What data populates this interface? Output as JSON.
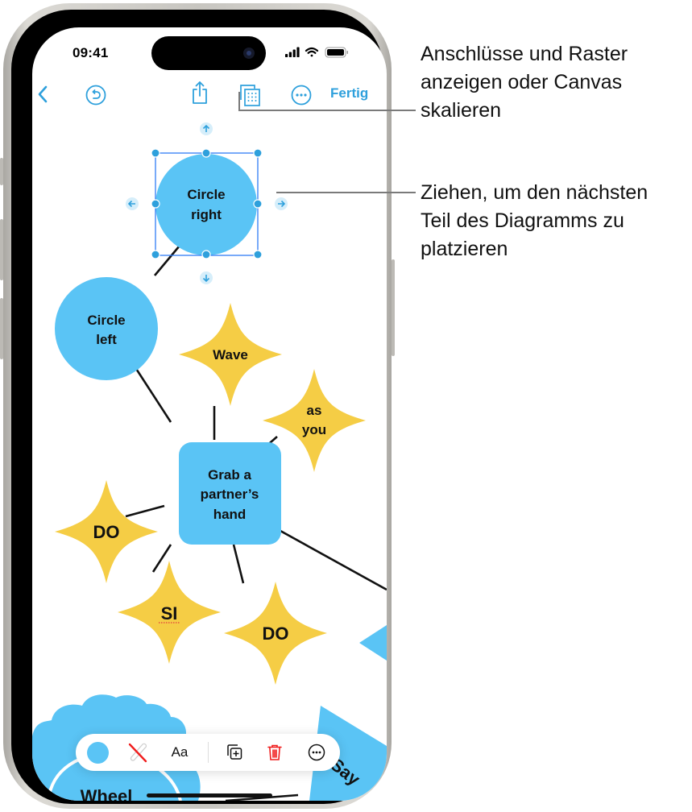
{
  "status_bar": {
    "time": "09:41",
    "icons": [
      "cellular-signal-icon",
      "wifi-icon",
      "battery-icon"
    ]
  },
  "toolbar": {
    "back_icon": "chevron-left-icon",
    "undo_icon": "undo-icon",
    "share_icon": "share-icon",
    "view_options_icon": "grid-layers-icon",
    "more_icon": "ellipsis-circle-icon",
    "done_label": "Fertig"
  },
  "diagram": {
    "colors": {
      "blue": "#5ac4f5",
      "yellow": "#f5cd45",
      "selection": "#2f7cf6",
      "handle": "#2ea0dc"
    },
    "nodes": [
      {
        "id": "circle-right",
        "shape": "circle",
        "lines": [
          "Circle",
          "right"
        ],
        "selected": true
      },
      {
        "id": "circle-left",
        "shape": "circle",
        "lines": [
          "Circle",
          "left"
        ]
      },
      {
        "id": "wave",
        "shape": "star",
        "lines": [
          "Wave"
        ]
      },
      {
        "id": "as-you",
        "shape": "star",
        "lines": [
          "as",
          "you"
        ]
      },
      {
        "id": "grab-hand",
        "shape": "rounded-rect",
        "lines": [
          "Grab a",
          "partner’s",
          "hand"
        ]
      },
      {
        "id": "do-left",
        "shape": "star",
        "lines": [
          "DO"
        ]
      },
      {
        "id": "si",
        "shape": "star",
        "lines": [
          "SI"
        ]
      },
      {
        "id": "do-bottom",
        "shape": "star",
        "lines": [
          "DO"
        ]
      },
      {
        "id": "wheel",
        "shape": "cloud",
        "lines": [
          "Wheel"
        ]
      },
      {
        "id": "say",
        "shape": "triangle",
        "lines": [
          "Say"
        ]
      }
    ],
    "connection_handles": [
      "arrow-up-icon",
      "arrow-down-icon",
      "arrow-left-icon",
      "arrow-right-icon"
    ]
  },
  "format_bar": {
    "fill_icon": "fill-color-swatch",
    "stroke_icon": "no-stroke-icon",
    "text_label": "Aa",
    "duplicate_icon": "duplicate-icon",
    "delete_icon": "trash-icon",
    "more_icon": "ellipsis-circle-icon"
  },
  "callouts": [
    {
      "text_lines": [
        "Anschlüsse und Raster",
        "anzeigen oder Canvas",
        "skalieren"
      ]
    },
    {
      "text_lines": [
        "Ziehen, um den nächsten",
        "Teil des Diagramms zu",
        "platzieren"
      ]
    }
  ]
}
